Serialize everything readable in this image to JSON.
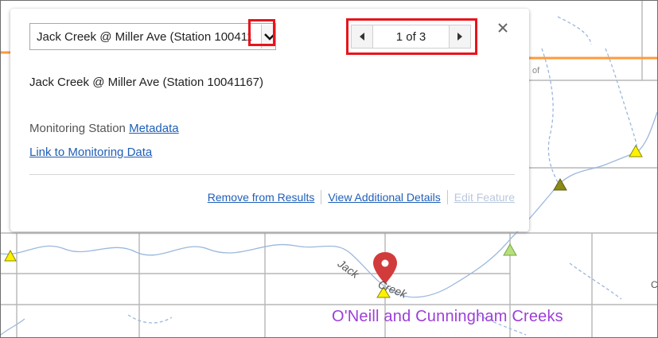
{
  "popup": {
    "selected_feature": "Jack Creek @ Miller Ave (Station 10041167)",
    "dropdown_icon": "chevron-down-icon",
    "pager": {
      "count": "1 of 3",
      "prev_icon": "triangle-left-icon",
      "next_icon": "triangle-right-icon"
    },
    "close_icon": "close-icon",
    "title": "Jack Creek @ Miller Ave (Station 10041167)",
    "metadata_prefix": "Monitoring Station ",
    "metadata_link": "Metadata",
    "monitoring_data_link": "Link to Monitoring Data",
    "actions": {
      "remove": "Remove from Results",
      "details": "View Additional Details",
      "edit": "Edit Feature"
    },
    "highlight_color": "#e8141c"
  },
  "map": {
    "area_label": "O'Neill and Cunningham Creeks",
    "stream_label_1": "Jack",
    "stream_label_2": "Creek",
    "fragment_of": "of",
    "fragment_c": "C",
    "marker_icon": "map-pin-icon",
    "station_icon": "triangle-marker-icon",
    "colors": {
      "stream": "#9bb8dc",
      "grid": "#b7b7b7",
      "road": "#ff9a3c",
      "label": "#9b3fd8",
      "pin": "#d23b3b",
      "triangle_yellow": "#fff200",
      "triangle_olive": "#8b8a1a",
      "triangle_green": "#b5e07a"
    }
  }
}
